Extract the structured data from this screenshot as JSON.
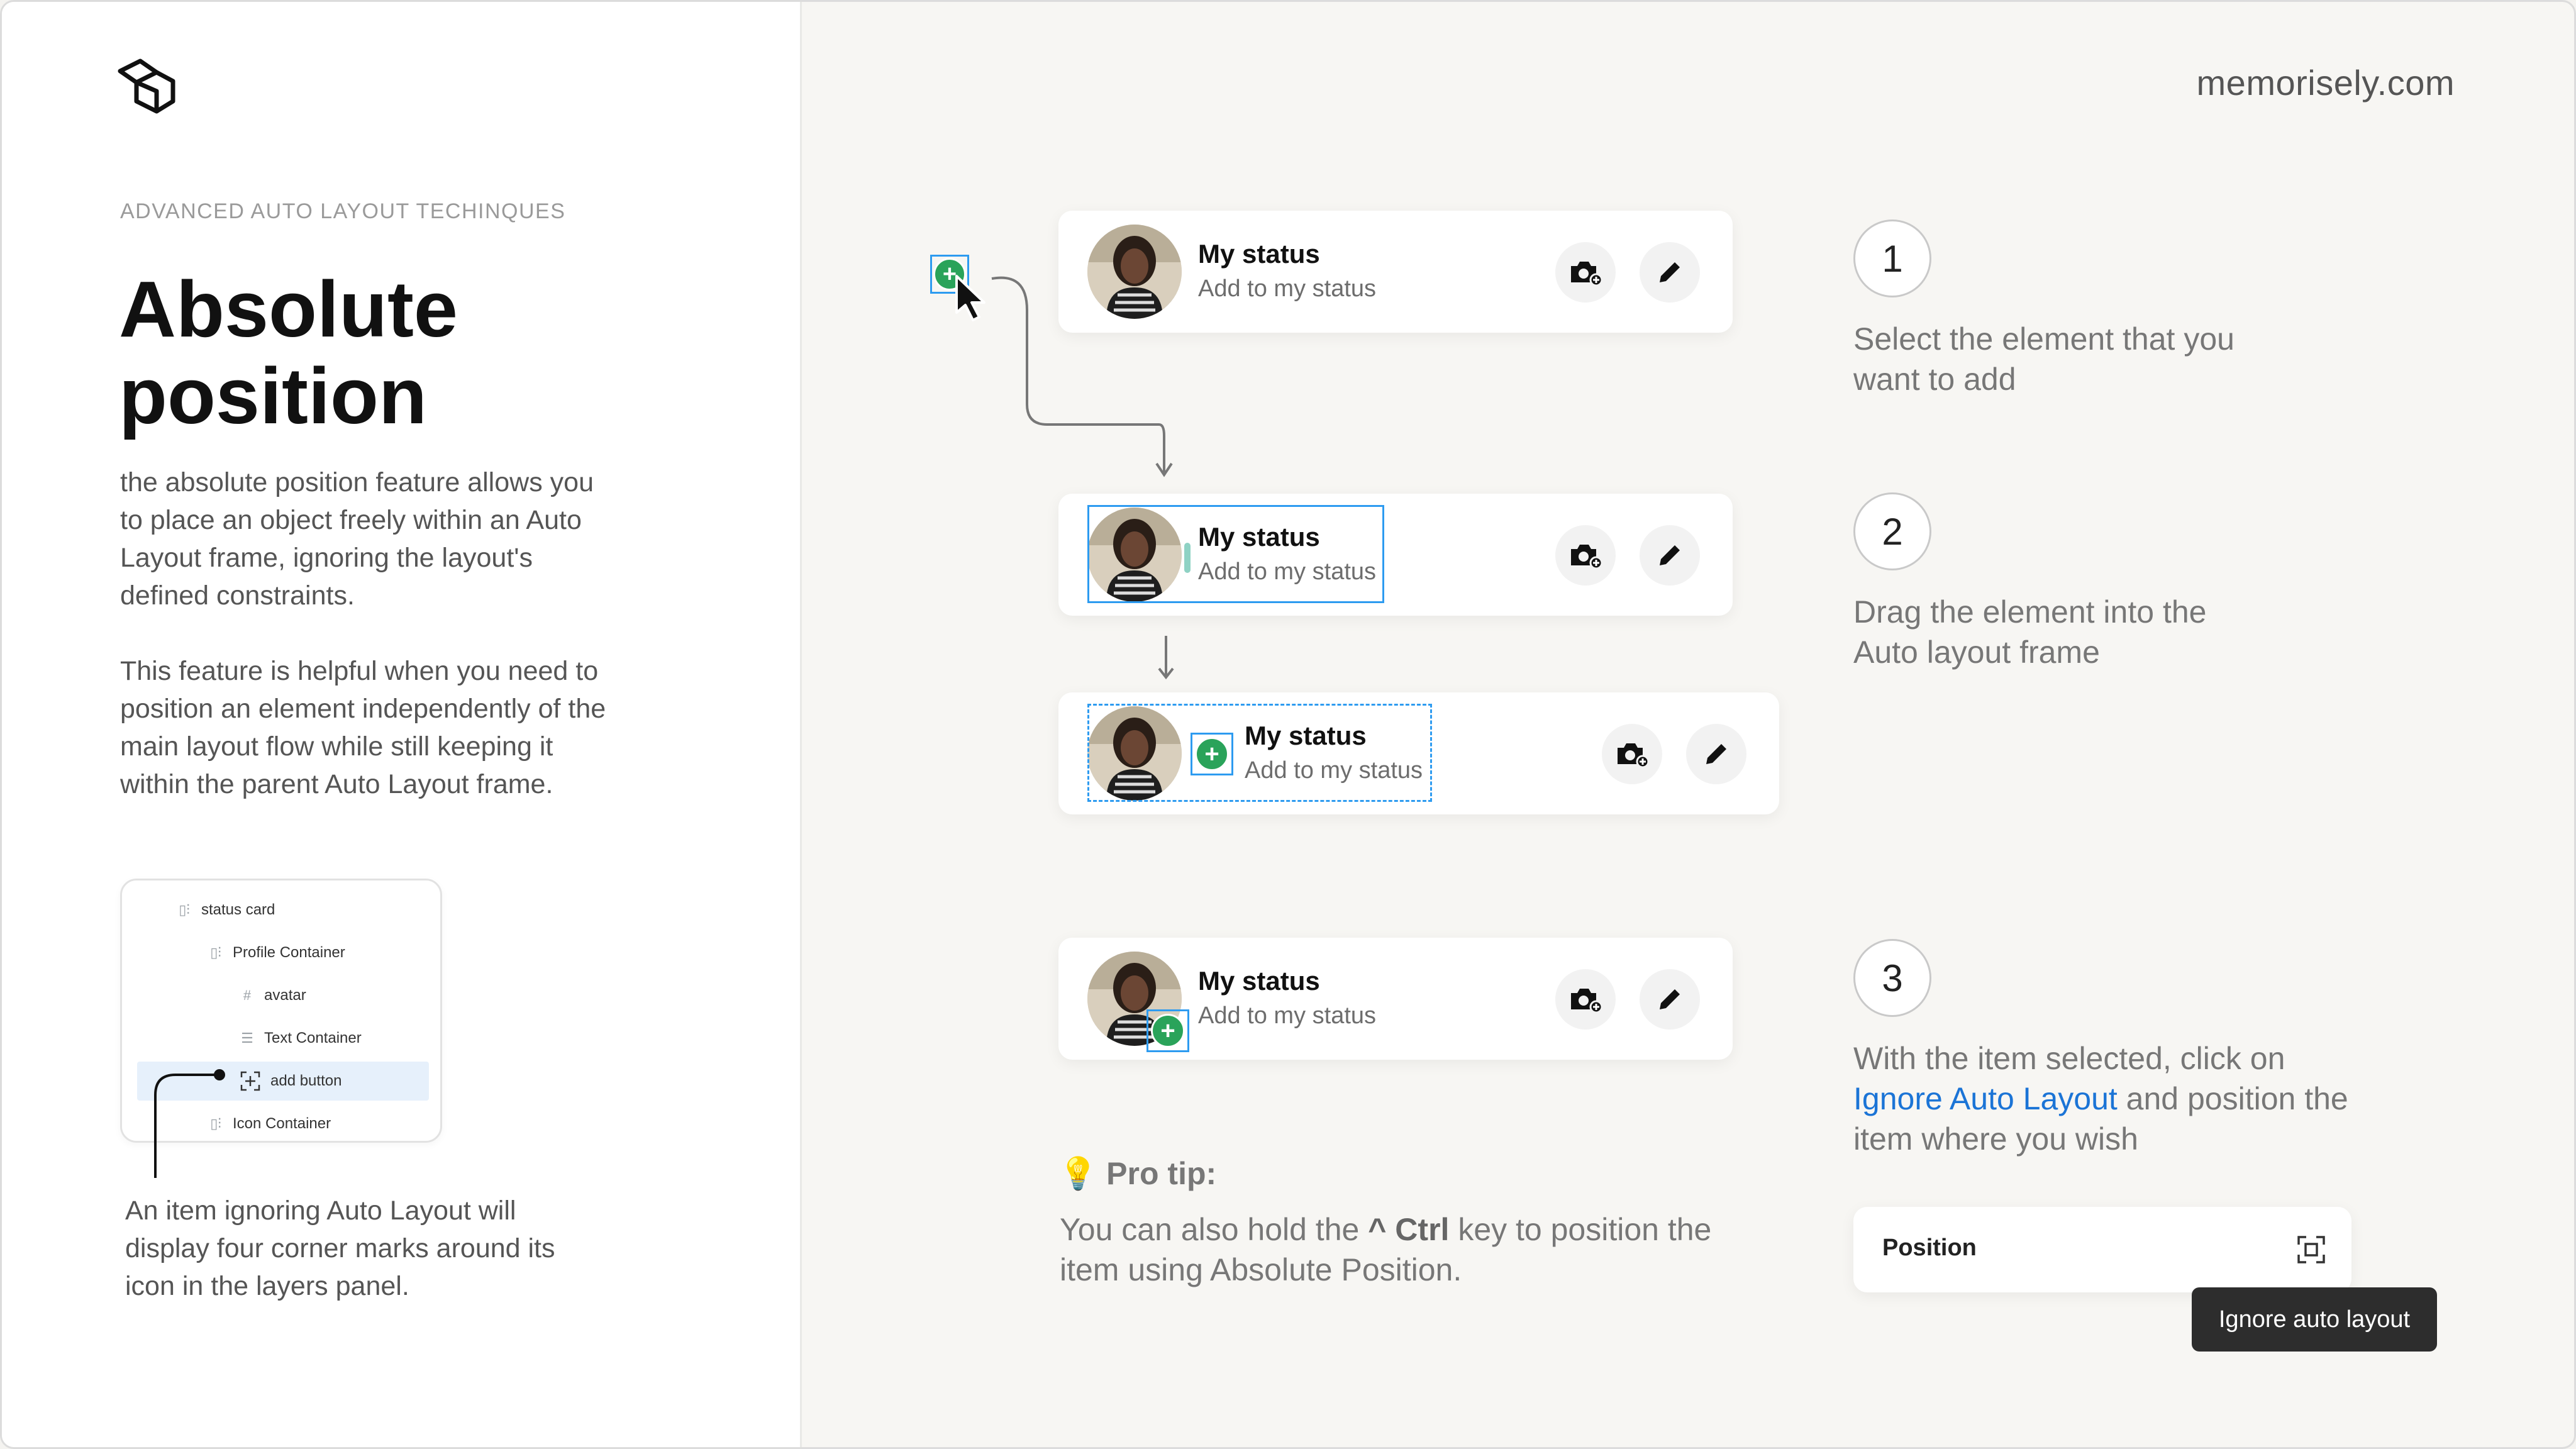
{
  "eyebrow": "ADVANCED AUTO LAYOUT TECHINQUES",
  "title": "Absolute position",
  "paragraph1": "the absolute position feature allows you to place an object freely within an Auto Layout frame, ignoring the layout's defined constraints.",
  "paragraph2": "This feature is helpful when you need to position an element independently of the main layout flow while still keeping it within the parent Auto Layout frame.",
  "layers": [
    {
      "label": "status card",
      "icon": "frame-auto-layout-icon"
    },
    {
      "label": "Profile Container",
      "icon": "frame-auto-layout-icon"
    },
    {
      "label": "avatar",
      "icon": "frame-hash-icon"
    },
    {
      "label": "Text Container",
      "icon": "text-lines-icon"
    },
    {
      "label": "add button",
      "icon": "absolute-position-icon",
      "selected": true
    },
    {
      "label": "Icon Container",
      "icon": "frame-auto-layout-icon"
    }
  ],
  "caption": "An item ignoring Auto Layout will display four corner marks around its icon in the layers panel.",
  "site": "memorisely.com",
  "card": {
    "name": "My status",
    "subtitle": "Add to my status",
    "camera_icon": "camera-plus-icon",
    "edit_icon": "pencil-icon"
  },
  "steps": [
    {
      "number": "1",
      "text": "Select the element that you want to add"
    },
    {
      "number": "2",
      "text": "Drag the element into the Auto layout frame"
    },
    {
      "number": "3",
      "pre": "With the item selected, click on ",
      "link": "Ignore Auto Layout",
      "post": " and position the item where you wish"
    }
  ],
  "protip": {
    "title": "Pro tip:",
    "icon": "lightbulb-icon",
    "pre": "You can also hold the ",
    "key": "^ Ctrl",
    "post": " key to position the item using Absolute Position."
  },
  "position_panel": {
    "label": "Position",
    "icon": "ignore-auto-layout-icon",
    "tooltip": "Ignore auto layout"
  },
  "colors": {
    "accent_green": "#2aa35a",
    "selection_blue": "#2d9bf0",
    "link_blue": "#1b74d6"
  }
}
